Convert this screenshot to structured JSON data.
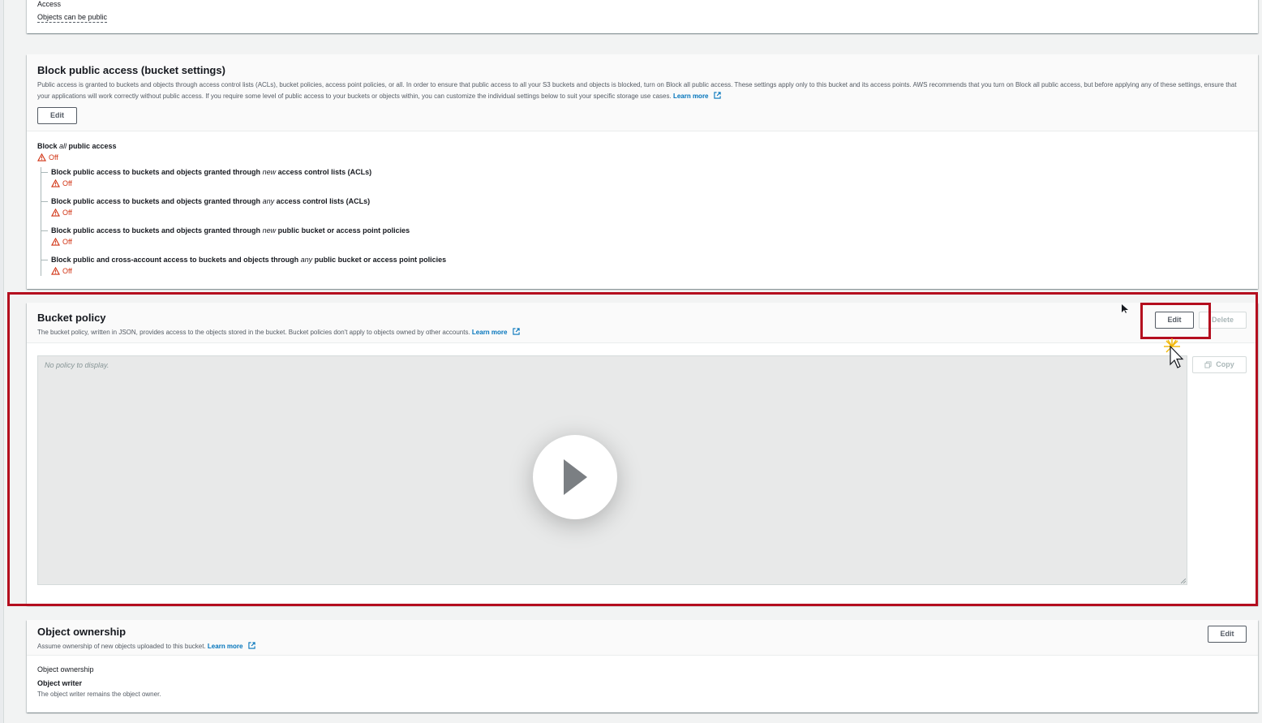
{
  "access": {
    "label": "Access",
    "value": "Objects can be public"
  },
  "block_public_access": {
    "title": "Block public access (bucket settings)",
    "description": "Public access is granted to buckets and objects through access control lists (ACLs), bucket policies, access point policies, or all. In order to ensure that public access to all your S3 buckets and objects is blocked, turn on Block all public access. These settings apply only to this bucket and its access points. AWS recommends that you turn on Block all public access, but before applying any of these settings, ensure that your applications will work correctly without public access. If you require some level of public access to your buckets or objects within, you can customize the individual settings below to suit your specific storage use cases.",
    "learn_more": "Learn more",
    "edit_label": "Edit",
    "main_option": {
      "prefix": "Block ",
      "emph": "all",
      "suffix": " public access",
      "status": "Off"
    },
    "options": [
      {
        "prefix": "Block public access to buckets and objects granted through ",
        "emph": "new",
        "suffix": " access control lists (ACLs)",
        "status": "Off"
      },
      {
        "prefix": "Block public access to buckets and objects granted through ",
        "emph": "any",
        "suffix": " access control lists (ACLs)",
        "status": "Off"
      },
      {
        "prefix": "Block public access to buckets and objects granted through ",
        "emph": "new",
        "suffix": " public bucket or access point policies",
        "status": "Off"
      },
      {
        "prefix": "Block public and cross-account access to buckets and objects through ",
        "emph": "any",
        "suffix": " public bucket or access point policies",
        "status": "Off"
      }
    ]
  },
  "bucket_policy": {
    "title": "Bucket policy",
    "description": "The bucket policy, written in JSON, provides access to the objects stored in the bucket. Bucket policies don't apply to objects owned by other accounts.",
    "learn_more": "Learn more",
    "edit_label": "Edit",
    "delete_label": "Delete",
    "copy_label": "Copy",
    "placeholder": "No policy to display."
  },
  "object_ownership": {
    "title": "Object ownership",
    "description": "Assume ownership of new objects uploaded to this bucket.",
    "learn_more": "Learn more",
    "edit_label": "Edit",
    "field_label": "Object ownership",
    "field_value": "Object writer",
    "field_hint": "The object writer remains the object owner."
  },
  "colors": {
    "accent_link": "#0073bb",
    "warning": "#d13212",
    "highlight": "#b40d1e"
  },
  "icons": [
    "external-link-icon",
    "warning-icon",
    "copy-icon",
    "play-icon",
    "cursor-icon"
  ]
}
